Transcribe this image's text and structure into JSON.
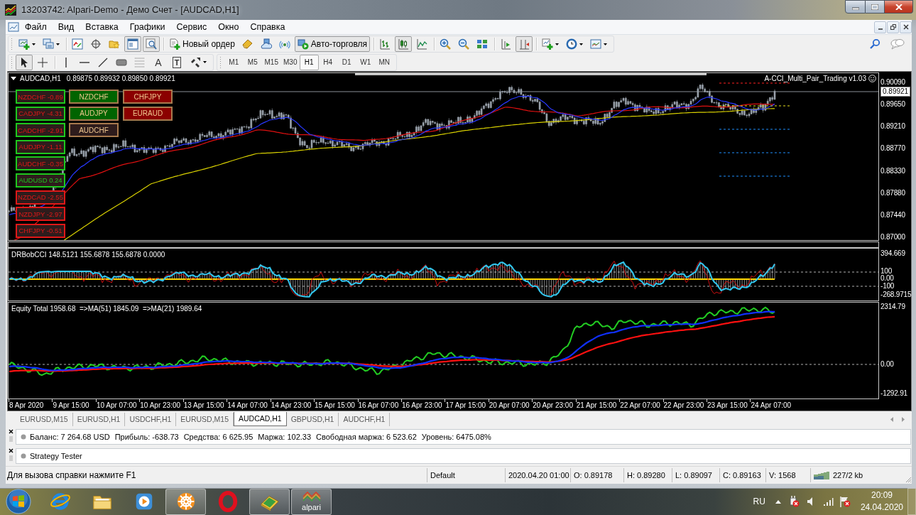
{
  "window": {
    "title": "13203742: Alpari-Demo - Демо Счет - [AUDCAD,H1]"
  },
  "menu": [
    "Файл",
    "Вид",
    "Вставка",
    "Графики",
    "Сервис",
    "Окно",
    "Справка"
  ],
  "toolbar_main": [
    [
      {
        "kind": "new-chart",
        "pressed": false
      },
      {
        "kind": "profiles",
        "pressed": false
      }
    ],
    [
      {
        "kind": "market-watch",
        "pressed": false
      },
      {
        "kind": "data-window",
        "pressed": false
      },
      {
        "kind": "navigator",
        "pressed": false
      },
      {
        "kind": "terminal",
        "pressed": true
      },
      {
        "kind": "tester",
        "pressed": true
      }
    ],
    [
      {
        "kind": "new-order",
        "label": "Новый ордер",
        "pressed": false
      },
      {
        "kind": "metaeditor",
        "pressed": false
      },
      {
        "kind": "vps",
        "pressed": false
      },
      {
        "kind": "signals",
        "pressed": false
      },
      {
        "kind": "autotrading",
        "label": "Авто-торговля",
        "pressed": true
      }
    ],
    [
      {
        "kind": "bar-chart",
        "pressed": false
      },
      {
        "kind": "candles",
        "pressed": true
      },
      {
        "kind": "line-chart",
        "pressed": false
      }
    ],
    [
      {
        "kind": "zoom-in",
        "pressed": false
      },
      {
        "kind": "zoom-out",
        "pressed": false
      },
      {
        "kind": "tile",
        "pressed": false
      }
    ],
    [
      {
        "kind": "autoscroll",
        "pressed": false
      },
      {
        "kind": "chart-shift",
        "pressed": true
      }
    ],
    [
      {
        "kind": "indicators",
        "pressed": false
      },
      {
        "kind": "periods",
        "pressed": false
      },
      {
        "kind": "templates",
        "pressed": false
      }
    ]
  ],
  "toolbar_tools": [
    [
      {
        "kind": "cursor",
        "pressed": true
      },
      {
        "kind": "crosshair",
        "pressed": false
      }
    ],
    [
      {
        "kind": "vline",
        "pressed": false
      },
      {
        "kind": "hline",
        "pressed": false
      },
      {
        "kind": "trendline",
        "pressed": false
      },
      {
        "kind": "rectangle",
        "pressed": false
      },
      {
        "kind": "fibonacci",
        "pressed": false
      },
      {
        "kind": "text",
        "label": "A",
        "pressed": false
      },
      {
        "kind": "label",
        "label": "T",
        "pressed": false
      },
      {
        "kind": "arrows",
        "pressed": false
      }
    ]
  ],
  "timeframes": [
    {
      "label": "M1",
      "selected": false
    },
    {
      "label": "M5",
      "selected": false
    },
    {
      "label": "M15",
      "selected": false
    },
    {
      "label": "M30",
      "selected": false
    },
    {
      "label": "H1",
      "selected": true
    },
    {
      "label": "H4",
      "selected": false
    },
    {
      "label": "D1",
      "selected": false
    },
    {
      "label": "W1",
      "selected": false
    },
    {
      "label": "MN",
      "selected": false
    }
  ],
  "chart": {
    "symbol": "AUDCAD,H1",
    "quote": "0.89875 0.89932 0.89850 0.89921",
    "indicator_name": "A-CCI_Multi_Pair_Trading v1.03",
    "current_price": "0.89921",
    "price_axis": [
      "0.90090",
      "0.89650",
      "0.89210",
      "0.88770",
      "0.88330",
      "0.87880",
      "0.87440",
      "0.87000"
    ],
    "signals": [
      {
        "label": "NZDCHF -0.89",
        "positive": false,
        "frame": {
          "color": "#1ec81e"
        }
      },
      {
        "label": "CADJPY -4.31",
        "positive": false,
        "frame": {
          "color": "#1ec81e"
        }
      },
      {
        "label": "CADCHF -2.91",
        "positive": false,
        "frame": {
          "color": "#1ec81e"
        }
      },
      {
        "label": "AUDJPY -1.11",
        "positive": false,
        "frame": {
          "color": "#1ec81e"
        }
      },
      {
        "label": "AUDCHF -0.35",
        "positive": false,
        "frame": {
          "color": "#1ec81e"
        }
      },
      {
        "label": "AUDUSD 0.24",
        "positive": true,
        "frame": {
          "color": "#1ec81e"
        }
      },
      {
        "label": "NZDCAD -2.55",
        "positive": false,
        "frame": {
          "color": "#e01818"
        }
      },
      {
        "label": "NZDJPY -2.97",
        "positive": false,
        "frame": {
          "color": "#e01818"
        }
      },
      {
        "label": "CHFJPY -0.51",
        "positive": false,
        "frame": {
          "color": "#e01818"
        }
      }
    ],
    "pair_buttons": [
      [
        {
          "label": "NZDCHF",
          "color": "#006400"
        },
        {
          "label": "CHFJPY",
          "color": "#8b0000"
        }
      ],
      [
        {
          "label": "AUDJPY",
          "color": "#006400"
        },
        {
          "label": "EURAUD",
          "color": "#8b0000"
        }
      ],
      [
        {
          "label": "AUDCHF",
          "color": "#2e1c1c"
        }
      ]
    ],
    "cci": {
      "label": "DRBobCCI 148.5121 155.6878 155.6878 0.0000",
      "axis": [
        "394.669",
        "100",
        "0.00",
        "-100",
        "-268.9715"
      ]
    },
    "equity": {
      "label": "Equity Total 1958.68  =>MA(51) 1845.09  =>MA(21) 1989.64",
      "axis": [
        "2314.79",
        "0.00",
        "-1292.91"
      ]
    },
    "time_axis": [
      "8 Apr 2020",
      "9 Apr 15:00",
      "10 Apr 07:00",
      "10 Apr 23:00",
      "13 Apr 15:00",
      "14 Apr 07:00",
      "14 Apr 23:00",
      "15 Apr 15:00",
      "16 Apr 07:00",
      "16 Apr 23:00",
      "17 Apr 15:00",
      "20 Apr 07:00",
      "20 Apr 23:00",
      "21 Apr 15:00",
      "22 Apr 07:00",
      "22 Apr 23:00",
      "23 Apr 15:00",
      "24 Apr 07:00"
    ]
  },
  "chart_tabs": [
    {
      "label": "EURUSD,M15",
      "selected": false
    },
    {
      "label": "EURUSD,H1",
      "selected": false
    },
    {
      "label": "USDCHF,H1",
      "selected": false
    },
    {
      "label": "EURUSD,M15",
      "selected": false
    },
    {
      "label": "AUDCAD,H1",
      "selected": true
    },
    {
      "label": "GBPUSD,H1",
      "selected": false
    },
    {
      "label": "AUDCHF,H1",
      "selected": false
    }
  ],
  "terminal": {
    "items": [
      "Баланс: 7 264.68 USD",
      "Прибыль: -638.73",
      "Средства: 6 625.95",
      "Маржа: 102.33",
      "Свободная маржа: 6 523.62",
      "Уровень: 6475.08%"
    ]
  },
  "tester": {
    "title": "Strategy Tester"
  },
  "status_bar": {
    "help": "Для вызова справки нажмите F1",
    "fields": [
      "Default",
      "2020.04.20 01:00",
      "O: 0.89178",
      "H: 0.89280",
      "L: 0.89097",
      "C: 0.89163",
      "V: 1568"
    ],
    "traffic": "227/2 kb"
  },
  "taskbar": {
    "apps": [
      {
        "kind": "ie",
        "active": false
      },
      {
        "kind": "folder",
        "active": false
      },
      {
        "kind": "media",
        "active": false
      },
      {
        "kind": "wheel",
        "active": true
      },
      {
        "kind": "opera",
        "active": false
      },
      {
        "kind": "book",
        "active": true
      },
      {
        "kind": "alpari",
        "label": "alpari",
        "active": true
      }
    ],
    "language": "RU",
    "time": "20:09",
    "date": "24.04.2020"
  }
}
